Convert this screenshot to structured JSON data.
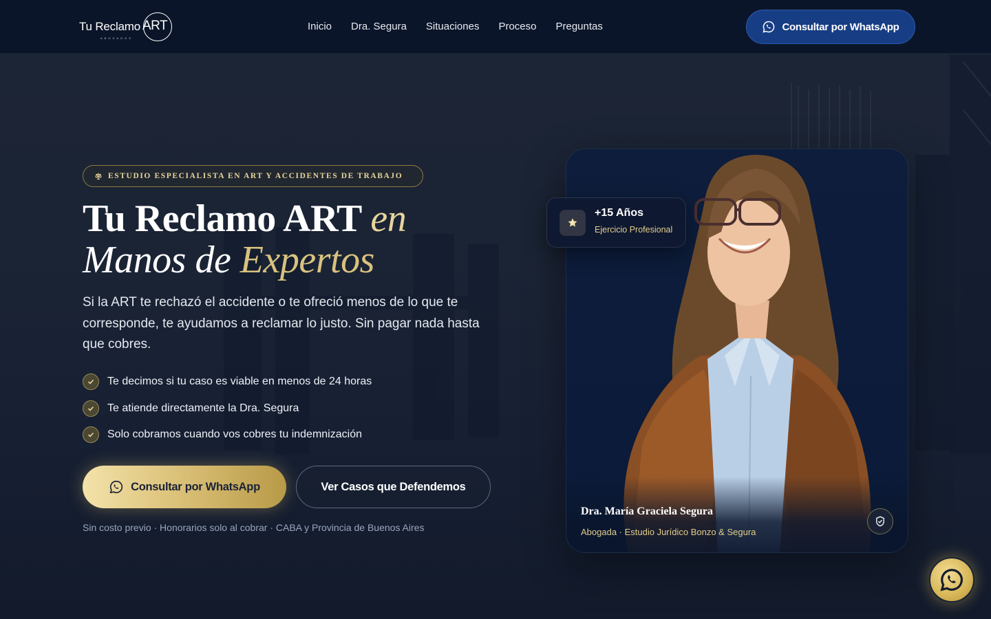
{
  "header": {
    "logo": {
      "text": "Tu Reclamo",
      "art": "ART",
      "sub": "ABOGADOS"
    },
    "nav": [
      "Inicio",
      "Dra. Segura",
      "Situaciones",
      "Proceso",
      "Preguntas"
    ],
    "cta_label": "Consultar por WhatsApp"
  },
  "hero": {
    "badge": "ESTUDIO ESPECIALISTA EN ART Y ACCIDENTES DE TRABAJO",
    "title_part1": "Tu Reclamo ART ",
    "title_part2": "en",
    "title_line2_a": "Manos de ",
    "title_line2_b": "Expertos",
    "subtitle": "Si la ART te rechazó el accidente o te ofreció menos de lo que te corresponde, te ayudamos a reclamar lo justo. Sin pagar nada hasta que cobres.",
    "checks": [
      "Te decimos si tu caso es viable en menos de 24 horas",
      "Te atiende directamente la Dra. Segura",
      "Solo cobramos cuando vos cobres tu indemnización"
    ],
    "primary_button": "Consultar por WhatsApp",
    "secondary_button": "Ver Casos que Defendemos",
    "footnote": "Sin costo previo · Honorarios solo al cobrar · CABA y Provincia de Buenos Aires"
  },
  "profile_card": {
    "name": "Dra. María Graciela Segura",
    "role": "Abogada · Estudio Jurídico Bonzo & Segura"
  },
  "years_badge": {
    "title": "+15 Años",
    "subtitle": "Ejercicio Profesional"
  },
  "colors": {
    "header_bg": "#0b1529",
    "gold": "#e8d59c",
    "cta_blue": "#173d84",
    "card_bg": "#0d1d3b"
  },
  "icons": {
    "whatsapp": "whatsapp-icon",
    "check": "check-icon",
    "star": "star-icon",
    "shield": "shield-check-icon",
    "scale": "scale-icon"
  }
}
